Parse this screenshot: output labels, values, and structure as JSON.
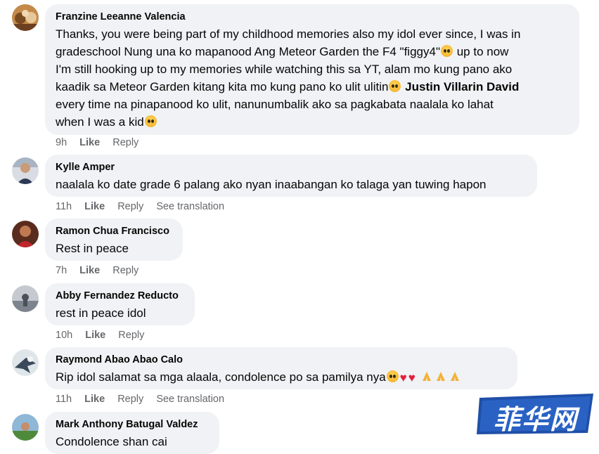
{
  "comments": [
    {
      "author": "Franzine Leeanne Valencia",
      "line1": "Thanks, you were being part of my childhood memories also my idol ever since, I was in",
      "line2a": "gradeschool Nung una ko mapanood Ang Meteor Garden the F4 \"figgy4\"",
      "line2b": " up to now",
      "line3": "I'm still hooking up to my memories while watching this sa YT, alam mo kung pano ako",
      "line4a": "kaadik sa Meteor Garden kitang kita mo kung pano ko ulit ulitin",
      "mention": "Justin Villarin David",
      "line5": "every time na pinapanood ko ulit, nanunumbalik ako sa pagkabata naalala ko lahat",
      "line6": "when I was a kid",
      "time": "9h",
      "like": "Like",
      "reply": "Reply"
    },
    {
      "author": "Kylle Amper",
      "text": "naalala ko date grade 6 palang ako nyan inaabangan ko talaga yan tuwing hapon",
      "time": "11h",
      "like": "Like",
      "reply": "Reply",
      "translate": "See translation"
    },
    {
      "author": "Ramon Chua Francisco",
      "text": "Rest in peace",
      "time": "7h",
      "like": "Like",
      "reply": "Reply"
    },
    {
      "author": "Abby Fernandez Reducto",
      "text": "rest in peace idol",
      "time": "10h",
      "like": "Like",
      "reply": "Reply"
    },
    {
      "author": "Raymond Abao Abao Calo",
      "text": "Rip idol salamat sa mga alaala, condolence po sa pamilya nya",
      "time": "11h",
      "like": "Like",
      "reply": "Reply",
      "translate": "See translation"
    },
    {
      "author": "Mark Anthony Batugal Valdez",
      "text": "Condolence shan cai"
    }
  ],
  "watermark": {
    "text": "菲华网"
  }
}
